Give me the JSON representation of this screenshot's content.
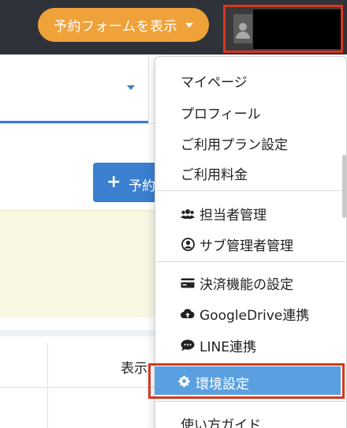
{
  "header": {
    "reserve_form_button": "予約フォームを表示"
  },
  "main": {
    "add_button_label": "予約",
    "table_column_label": "表示"
  },
  "menu": {
    "items": [
      {
        "label": "マイページ"
      },
      {
        "label": "プロフィール"
      },
      {
        "label": "ご利用プラン設定"
      },
      {
        "label": "ご利用料金"
      },
      {
        "label": "担当者管理",
        "icon": "users-icon"
      },
      {
        "label": "サブ管理者管理",
        "icon": "user-circle-icon"
      },
      {
        "label": "決済機能の設定",
        "icon": "credit-card-icon"
      },
      {
        "label": "GoogleDrive連携",
        "icon": "cloud-upload-icon"
      },
      {
        "label": "LINE連携",
        "icon": "chat-bubble-icon"
      },
      {
        "label": "環境設定",
        "icon": "gear-icon",
        "active": true
      },
      {
        "label": "使い方ガイド"
      }
    ]
  },
  "colors": {
    "topbar": "#2f3238",
    "reserve_button": "#f0a23a",
    "primary": "#3a7fd0",
    "highlight_border": "#d8371f",
    "active_item": "#5aa0e0"
  }
}
